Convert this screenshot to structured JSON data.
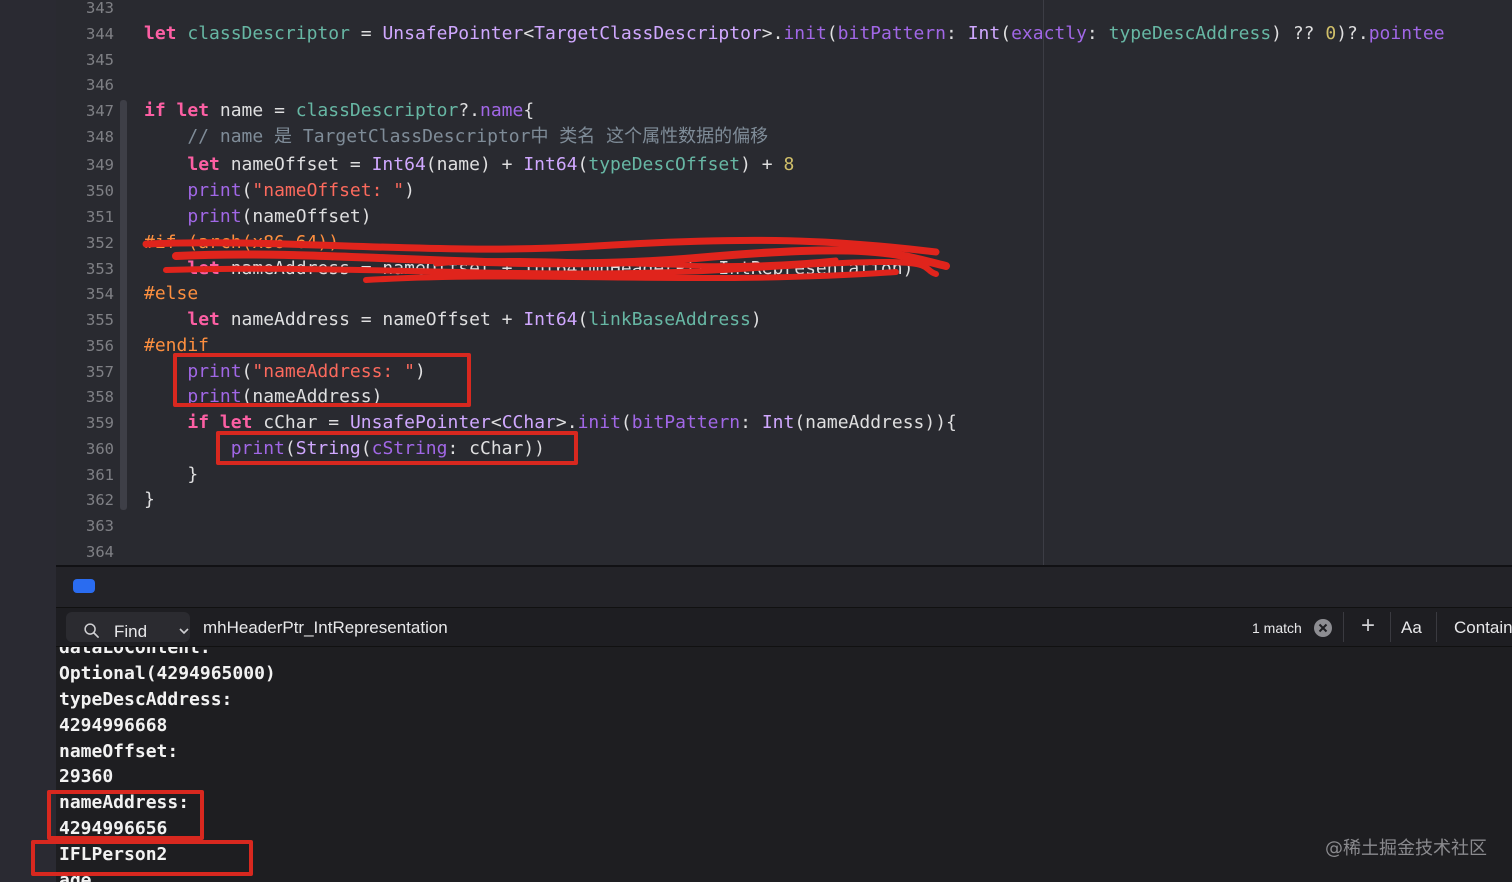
{
  "editor": {
    "line_numbers": [
      "343",
      "344",
      "345",
      "346",
      "347",
      "348",
      "349",
      "350",
      "351",
      "352",
      "353",
      "354",
      "355",
      "356",
      "357",
      "358",
      "359",
      "360",
      "361",
      "362",
      "363",
      "364"
    ],
    "code": {
      "l344": [
        {
          "c": "kw",
          "t": "let"
        },
        {
          "c": "",
          "t": " "
        },
        {
          "c": "fn",
          "t": "classDescriptor"
        },
        {
          "c": "",
          "t": " = "
        },
        {
          "c": "ty2",
          "t": "UnsafePointer"
        },
        {
          "c": "",
          "t": "<"
        },
        {
          "c": "ty2",
          "t": "TargetClassDescriptor"
        },
        {
          "c": "",
          "t": ">."
        },
        {
          "c": "prop",
          "t": "init"
        },
        {
          "c": "",
          "t": "("
        },
        {
          "c": "prop",
          "t": "bitPattern"
        },
        {
          "c": "",
          "t": ": "
        },
        {
          "c": "ty2",
          "t": "Int"
        },
        {
          "c": "",
          "t": "("
        },
        {
          "c": "prop",
          "t": "exactly"
        },
        {
          "c": "",
          "t": ": "
        },
        {
          "c": "fn",
          "t": "typeDescAddress"
        },
        {
          "c": "",
          "t": ") ?? "
        },
        {
          "c": "num",
          "t": "0"
        },
        {
          "c": "",
          "t": ")?."
        },
        {
          "c": "prop",
          "t": "pointee"
        }
      ],
      "l347": [
        {
          "c": "kw",
          "t": "if"
        },
        {
          "c": "",
          "t": " "
        },
        {
          "c": "kw",
          "t": "let"
        },
        {
          "c": "",
          "t": " name = "
        },
        {
          "c": "fn",
          "t": "classDescriptor"
        },
        {
          "c": "",
          "t": "?."
        },
        {
          "c": "prop",
          "t": "name"
        },
        {
          "c": "",
          "t": "{"
        }
      ],
      "l348": [
        {
          "c": "cm",
          "t": "    // name 是 TargetClassDescriptor中 类名 这个属性数据的偏移"
        }
      ],
      "l349": [
        {
          "c": "",
          "t": "    "
        },
        {
          "c": "kw",
          "t": "let"
        },
        {
          "c": "",
          "t": " nameOffset = "
        },
        {
          "c": "ty2",
          "t": "Int64"
        },
        {
          "c": "",
          "t": "(name) + "
        },
        {
          "c": "ty2",
          "t": "Int64"
        },
        {
          "c": "",
          "t": "("
        },
        {
          "c": "fn",
          "t": "typeDescOffset"
        },
        {
          "c": "",
          "t": ") + "
        },
        {
          "c": "num",
          "t": "8"
        }
      ],
      "l350": [
        {
          "c": "",
          "t": "    "
        },
        {
          "c": "ty",
          "t": "print"
        },
        {
          "c": "",
          "t": "("
        },
        {
          "c": "str",
          "t": "\"nameOffset: \""
        },
        {
          "c": "",
          "t": ")"
        }
      ],
      "l351": [
        {
          "c": "",
          "t": "    "
        },
        {
          "c": "ty",
          "t": "print"
        },
        {
          "c": "",
          "t": "(nameOffset)"
        }
      ],
      "l352": [
        {
          "c": "pp",
          "t": "#if (arch(x86_64))"
        }
      ],
      "l353": [
        {
          "c": "",
          "t": "    "
        },
        {
          "c": "kw",
          "t": "let"
        },
        {
          "c": "",
          "t": " nameAddress = nameOffset + Int64(mhHeaderPtr_IntRepresentation)"
        }
      ],
      "l354": [
        {
          "c": "pp",
          "t": "#else"
        }
      ],
      "l355": [
        {
          "c": "",
          "t": "    "
        },
        {
          "c": "kw",
          "t": "let"
        },
        {
          "c": "",
          "t": " nameAddress = nameOffset + "
        },
        {
          "c": "ty2",
          "t": "Int64"
        },
        {
          "c": "",
          "t": "("
        },
        {
          "c": "fn",
          "t": "linkBaseAddress"
        },
        {
          "c": "",
          "t": ")"
        }
      ],
      "l356": [
        {
          "c": "pp",
          "t": "#endif"
        }
      ],
      "l357": [
        {
          "c": "",
          "t": "    "
        },
        {
          "c": "ty",
          "t": "print"
        },
        {
          "c": "",
          "t": "("
        },
        {
          "c": "str",
          "t": "\"nameAddress: \""
        },
        {
          "c": "",
          "t": ")"
        }
      ],
      "l358": [
        {
          "c": "",
          "t": "    "
        },
        {
          "c": "ty",
          "t": "print"
        },
        {
          "c": "",
          "t": "(nameAddress)"
        }
      ],
      "l359": [
        {
          "c": "",
          "t": "    "
        },
        {
          "c": "kw",
          "t": "if"
        },
        {
          "c": "",
          "t": " "
        },
        {
          "c": "kw",
          "t": "let"
        },
        {
          "c": "",
          "t": " cChar = "
        },
        {
          "c": "ty2",
          "t": "UnsafePointer"
        },
        {
          "c": "",
          "t": "<"
        },
        {
          "c": "ty2",
          "t": "CChar"
        },
        {
          "c": "",
          "t": ">."
        },
        {
          "c": "prop",
          "t": "init"
        },
        {
          "c": "",
          "t": "("
        },
        {
          "c": "prop",
          "t": "bitPattern"
        },
        {
          "c": "",
          "t": ": "
        },
        {
          "c": "ty2",
          "t": "Int"
        },
        {
          "c": "",
          "t": "(nameAddress)){"
        }
      ],
      "l360": [
        {
          "c": "",
          "t": "        "
        },
        {
          "c": "ty",
          "t": "print"
        },
        {
          "c": "",
          "t": "("
        },
        {
          "c": "ty2",
          "t": "String"
        },
        {
          "c": "",
          "t": "("
        },
        {
          "c": "prop",
          "t": "cString"
        },
        {
          "c": "",
          "t": ": cChar))"
        }
      ],
      "l361": [
        {
          "c": "",
          "t": "    }"
        }
      ],
      "l362": [
        {
          "c": "",
          "t": "}"
        }
      ]
    }
  },
  "findbar": {
    "mode": "Find",
    "query": "mhHeaderPtr_IntRepresentation",
    "match_count": "1 match",
    "case_toggle": "Aa",
    "match_type": "Contains"
  },
  "console": {
    "lines": [
      "dataLoContent:",
      "Optional(4294965000)",
      "typeDescAddress:",
      "4294996668",
      "nameOffset:",
      "29360",
      "nameAddress:",
      "4294996656",
      "IFLPerson2",
      "age"
    ]
  },
  "watermark": "@稀土掘金技术社区",
  "colors": {
    "annotation_red": "#d8281f",
    "keyword": "#fc5fa3",
    "string": "#fc6a5d",
    "preprocessor": "#fd8f3f"
  }
}
